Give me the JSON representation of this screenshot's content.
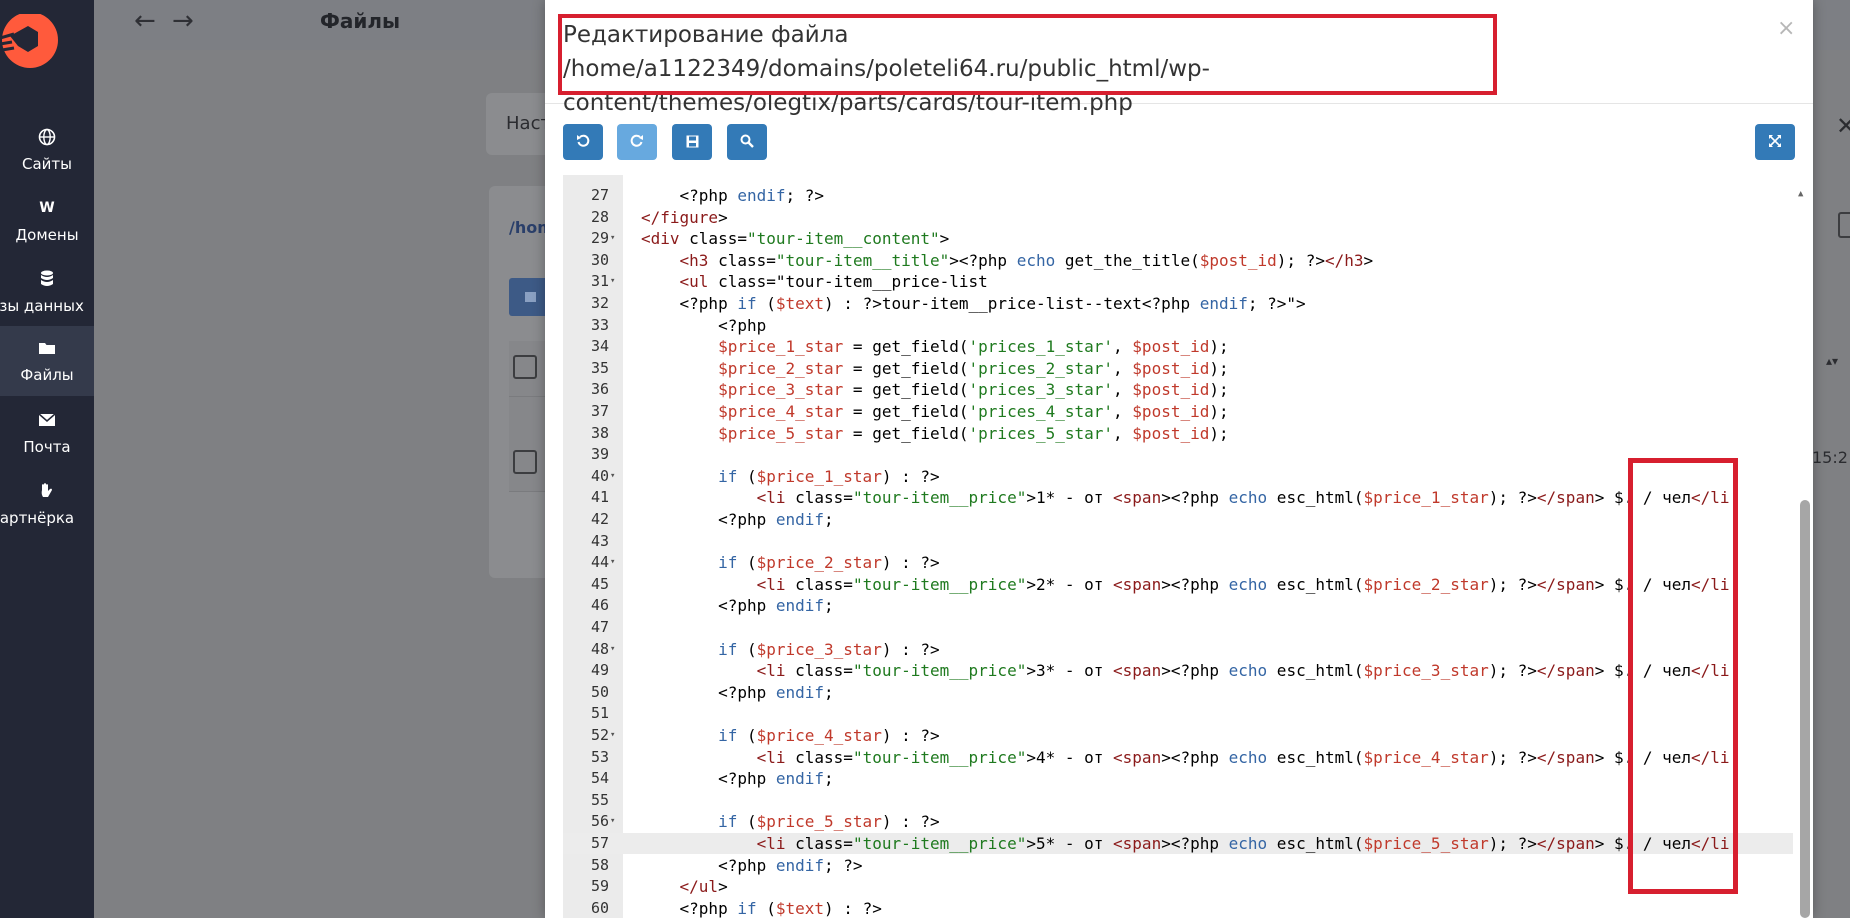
{
  "sidebar": {
    "items": [
      {
        "label": "Сайты",
        "icon": "globe-icon"
      },
      {
        "label": "Домены",
        "icon": "w-icon"
      },
      {
        "label": "азы данных",
        "icon": "database-icon"
      },
      {
        "label": "Файлы",
        "icon": "folder-icon",
        "active": true
      },
      {
        "label": "Почта",
        "icon": "mail-icon"
      },
      {
        "label": "артнёрка",
        "icon": "hand-icon"
      }
    ]
  },
  "topbar": {
    "back": "←",
    "forward": "→",
    "title": "Файлы"
  },
  "background": {
    "settings_tab": "Наст",
    "path": "/hom",
    "time": "15:2"
  },
  "modal": {
    "title": "Редактирование файла /home/a1122349/domains/poleteli64.ru/public_html/wp-content/themes/olegtix/parts/cards/tour-item.php",
    "close": "×"
  },
  "editor": {
    "active_line": "57",
    "lines": [
      {
        "n": "27",
        "fold": ""
      },
      {
        "n": "28",
        "fold": ""
      },
      {
        "n": "29",
        "fold": "▾"
      },
      {
        "n": "30",
        "fold": ""
      },
      {
        "n": "31",
        "fold": "▾"
      },
      {
        "n": "32",
        "fold": ""
      },
      {
        "n": "33",
        "fold": ""
      },
      {
        "n": "34",
        "fold": ""
      },
      {
        "n": "35",
        "fold": ""
      },
      {
        "n": "36",
        "fold": ""
      },
      {
        "n": "37",
        "fold": ""
      },
      {
        "n": "38",
        "fold": ""
      },
      {
        "n": "39",
        "fold": ""
      },
      {
        "n": "40",
        "fold": "▾"
      },
      {
        "n": "41",
        "fold": ""
      },
      {
        "n": "42",
        "fold": ""
      },
      {
        "n": "43",
        "fold": ""
      },
      {
        "n": "44",
        "fold": "▾"
      },
      {
        "n": "45",
        "fold": ""
      },
      {
        "n": "46",
        "fold": ""
      },
      {
        "n": "47",
        "fold": ""
      },
      {
        "n": "48",
        "fold": "▾"
      },
      {
        "n": "49",
        "fold": ""
      },
      {
        "n": "50",
        "fold": ""
      },
      {
        "n": "51",
        "fold": ""
      },
      {
        "n": "52",
        "fold": "▾"
      },
      {
        "n": "53",
        "fold": ""
      },
      {
        "n": "54",
        "fold": ""
      },
      {
        "n": "55",
        "fold": ""
      },
      {
        "n": "56",
        "fold": "▾"
      },
      {
        "n": "57",
        "fold": ""
      },
      {
        "n": "58",
        "fold": ""
      },
      {
        "n": "59",
        "fold": ""
      },
      {
        "n": "60",
        "fold": ""
      }
    ],
    "code": [
      "    <?php endif; ?>",
      "</figure>",
      "<div class=\"tour-item__content\">",
      "    <h3 class=\"tour-item__title\"><?php echo get_the_title($post_id); ?></h3>",
      "    <ul class=\"tour-item__price-list",
      "    <?php if ($text) : ?>tour-item__price-list--text<?php endif; ?>\">",
      "        <?php",
      "        $price_1_star = get_field('prices_1_star', $post_id);",
      "        $price_2_star = get_field('prices_2_star', $post_id);",
      "        $price_3_star = get_field('prices_3_star', $post_id);",
      "        $price_4_star = get_field('prices_4_star', $post_id);",
      "        $price_5_star = get_field('prices_5_star', $post_id);",
      "",
      "        if ($price_1_star) : ?>",
      "            <li class=\"tour-item__price\">1* - от <span><?php echo esc_html($price_1_star); ?></span> $. / чел</li",
      "        <?php endif;",
      "",
      "        if ($price_2_star) : ?>",
      "            <li class=\"tour-item__price\">2* - от <span><?php echo esc_html($price_2_star); ?></span> $. / чел</li",
      "        <?php endif;",
      "",
      "        if ($price_3_star) : ?>",
      "            <li class=\"tour-item__price\">3* - от <span><?php echo esc_html($price_3_star); ?></span> $. / чел</li",
      "        <?php endif;",
      "",
      "        if ($price_4_star) : ?>",
      "            <li class=\"tour-item__price\">4* - от <span><?php echo esc_html($price_4_star); ?></span> $. / чел</li",
      "        <?php endif;",
      "",
      "        if ($price_5_star) : ?>",
      "            <li class=\"tour-item__price\">5* - от <span><?php echo esc_html($price_5_star); ?></span> $. / чел</li",
      "        <?php endif; ?>",
      "    </ul>",
      "    <?php if ($text) : ?>"
    ]
  },
  "colors": {
    "sidebar_bg": "#232736",
    "accent_red": "#d71f2f",
    "button_blue": "#337ab7",
    "logo_orange": "#ff5a3c"
  }
}
